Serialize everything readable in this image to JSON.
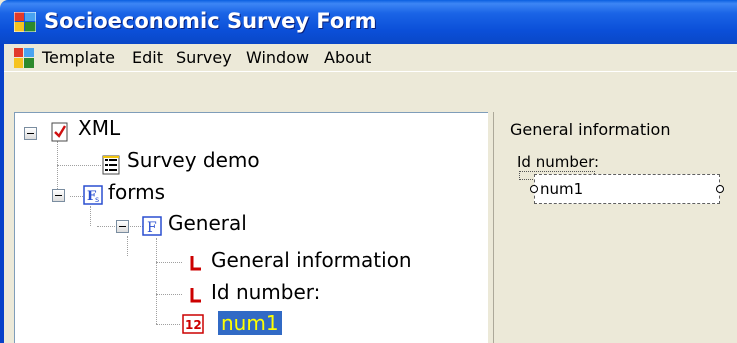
{
  "window": {
    "title": "Socioeconomic Survey Form"
  },
  "menu": {
    "items": [
      "Template",
      "Edit",
      "Survey",
      "Window",
      "About"
    ]
  },
  "tree": {
    "nodes": [
      {
        "label": "XML",
        "icon": "xml-document-icon"
      },
      {
        "label": "Survey demo",
        "icon": "survey-list-icon"
      },
      {
        "label": "forms",
        "icon": "forms-icon"
      },
      {
        "label": "General",
        "icon": "form-icon"
      },
      {
        "label": "General information",
        "icon": "label-icon"
      },
      {
        "label": "Id number:",
        "icon": "label-icon"
      },
      {
        "label": "num1",
        "icon": "numeric-field-icon",
        "selected": true
      }
    ]
  },
  "designer": {
    "panel_title": "General information",
    "field_label": "Id number:",
    "field_value": "num1"
  },
  "colors": {
    "titlebar": "#0a47c7",
    "selection_bg": "#316ac5",
    "selection_text": "#ffff00",
    "label_icon_red": "#cc0000"
  }
}
